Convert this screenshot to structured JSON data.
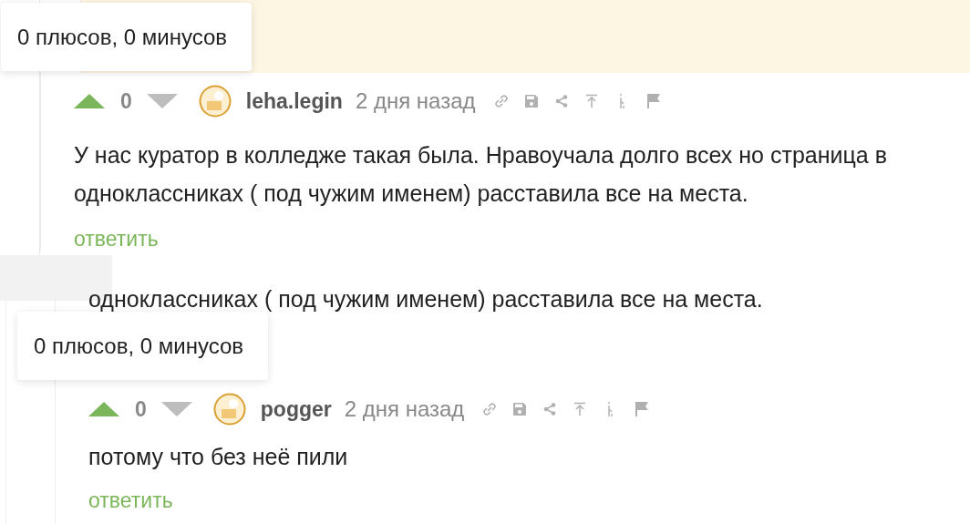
{
  "comments": [
    {
      "rating": "0",
      "tooltip": "0 плюсов, 0 минусов",
      "author": "leha.legin",
      "time": "2 дня назад",
      "text": "У нас куратор в колледже такая была. Нравоучала долго всех но страница в одноклассниках ( под чужим именем) расставила все на места.",
      "reply": "ответить"
    },
    {
      "rating": "0",
      "tooltip": "0 плюсов, 0 минусов",
      "author": "pogger",
      "time": "2 дня назад",
      "text": "потому что без неё пили",
      "reply": "ответить"
    }
  ],
  "fragment": "одноклассниках ( под чужим именем) расставила все на места."
}
